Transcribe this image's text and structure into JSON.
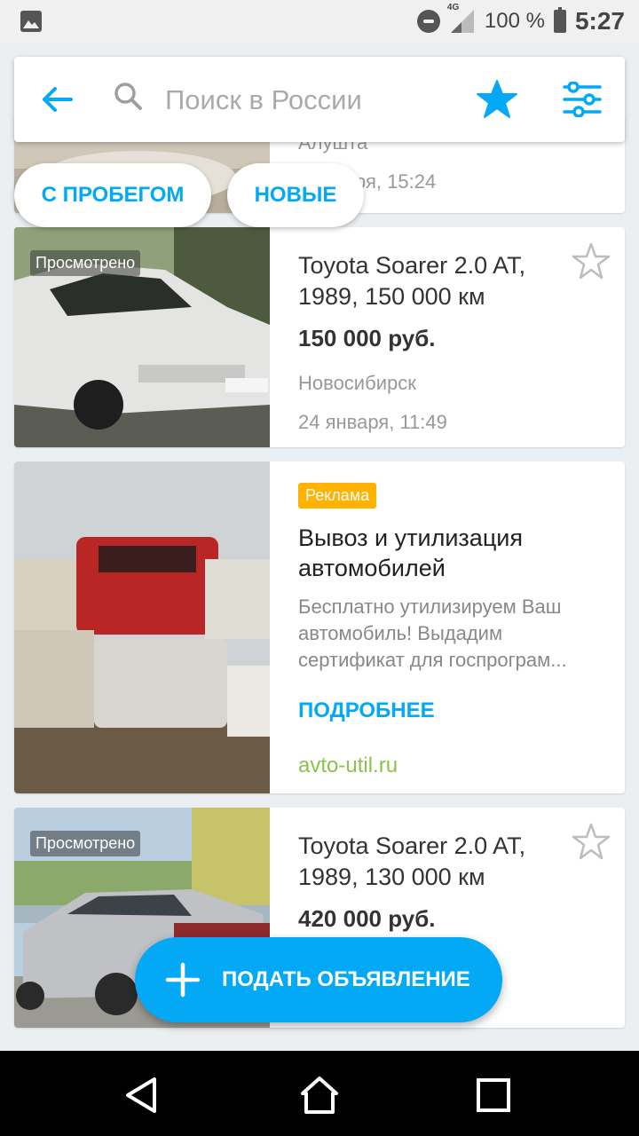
{
  "status_bar": {
    "network": "4G",
    "battery": "100 %",
    "time": "5:27"
  },
  "search": {
    "placeholder": "Поиск в России"
  },
  "chips": {
    "used": "С ПРОБЕГОМ",
    "new": "НОВЫЕ"
  },
  "listings": [
    {
      "city": "Алушта",
      "date": "ря, 15:24"
    },
    {
      "viewed": "Просмотрено",
      "title_line1": "Toyota Soarer 2.0 AT,",
      "title_line2": "1989, 150 000 км",
      "price": "150 000 руб.",
      "city": "Новосибирск",
      "date": "24 января, 11:49"
    },
    {
      "viewed": "Просмотрено",
      "title_line1": "Toyota Soarer 2.0 AT,",
      "title_line2": "1989, 130 000 км",
      "price": "420 000 руб."
    }
  ],
  "ad": {
    "badge": "Реклама",
    "title_line1": "Вывоз и утилизация",
    "title_line2": "автомобилей",
    "desc_line1": "Бесплатно утилизируем Ваш",
    "desc_line2": "автомобиль! Выдадим",
    "desc_line3": "сертификат для госпрограм...",
    "more": "ПОДРОБНЕЕ",
    "site": "avto-util.ru"
  },
  "fab": {
    "label": "ПОДАТЬ ОБЪЯВЛЕНИЕ"
  },
  "colors": {
    "accent": "#03a9f4",
    "ad_badge": "#ffb300",
    "ad_site": "#8bc34a"
  }
}
